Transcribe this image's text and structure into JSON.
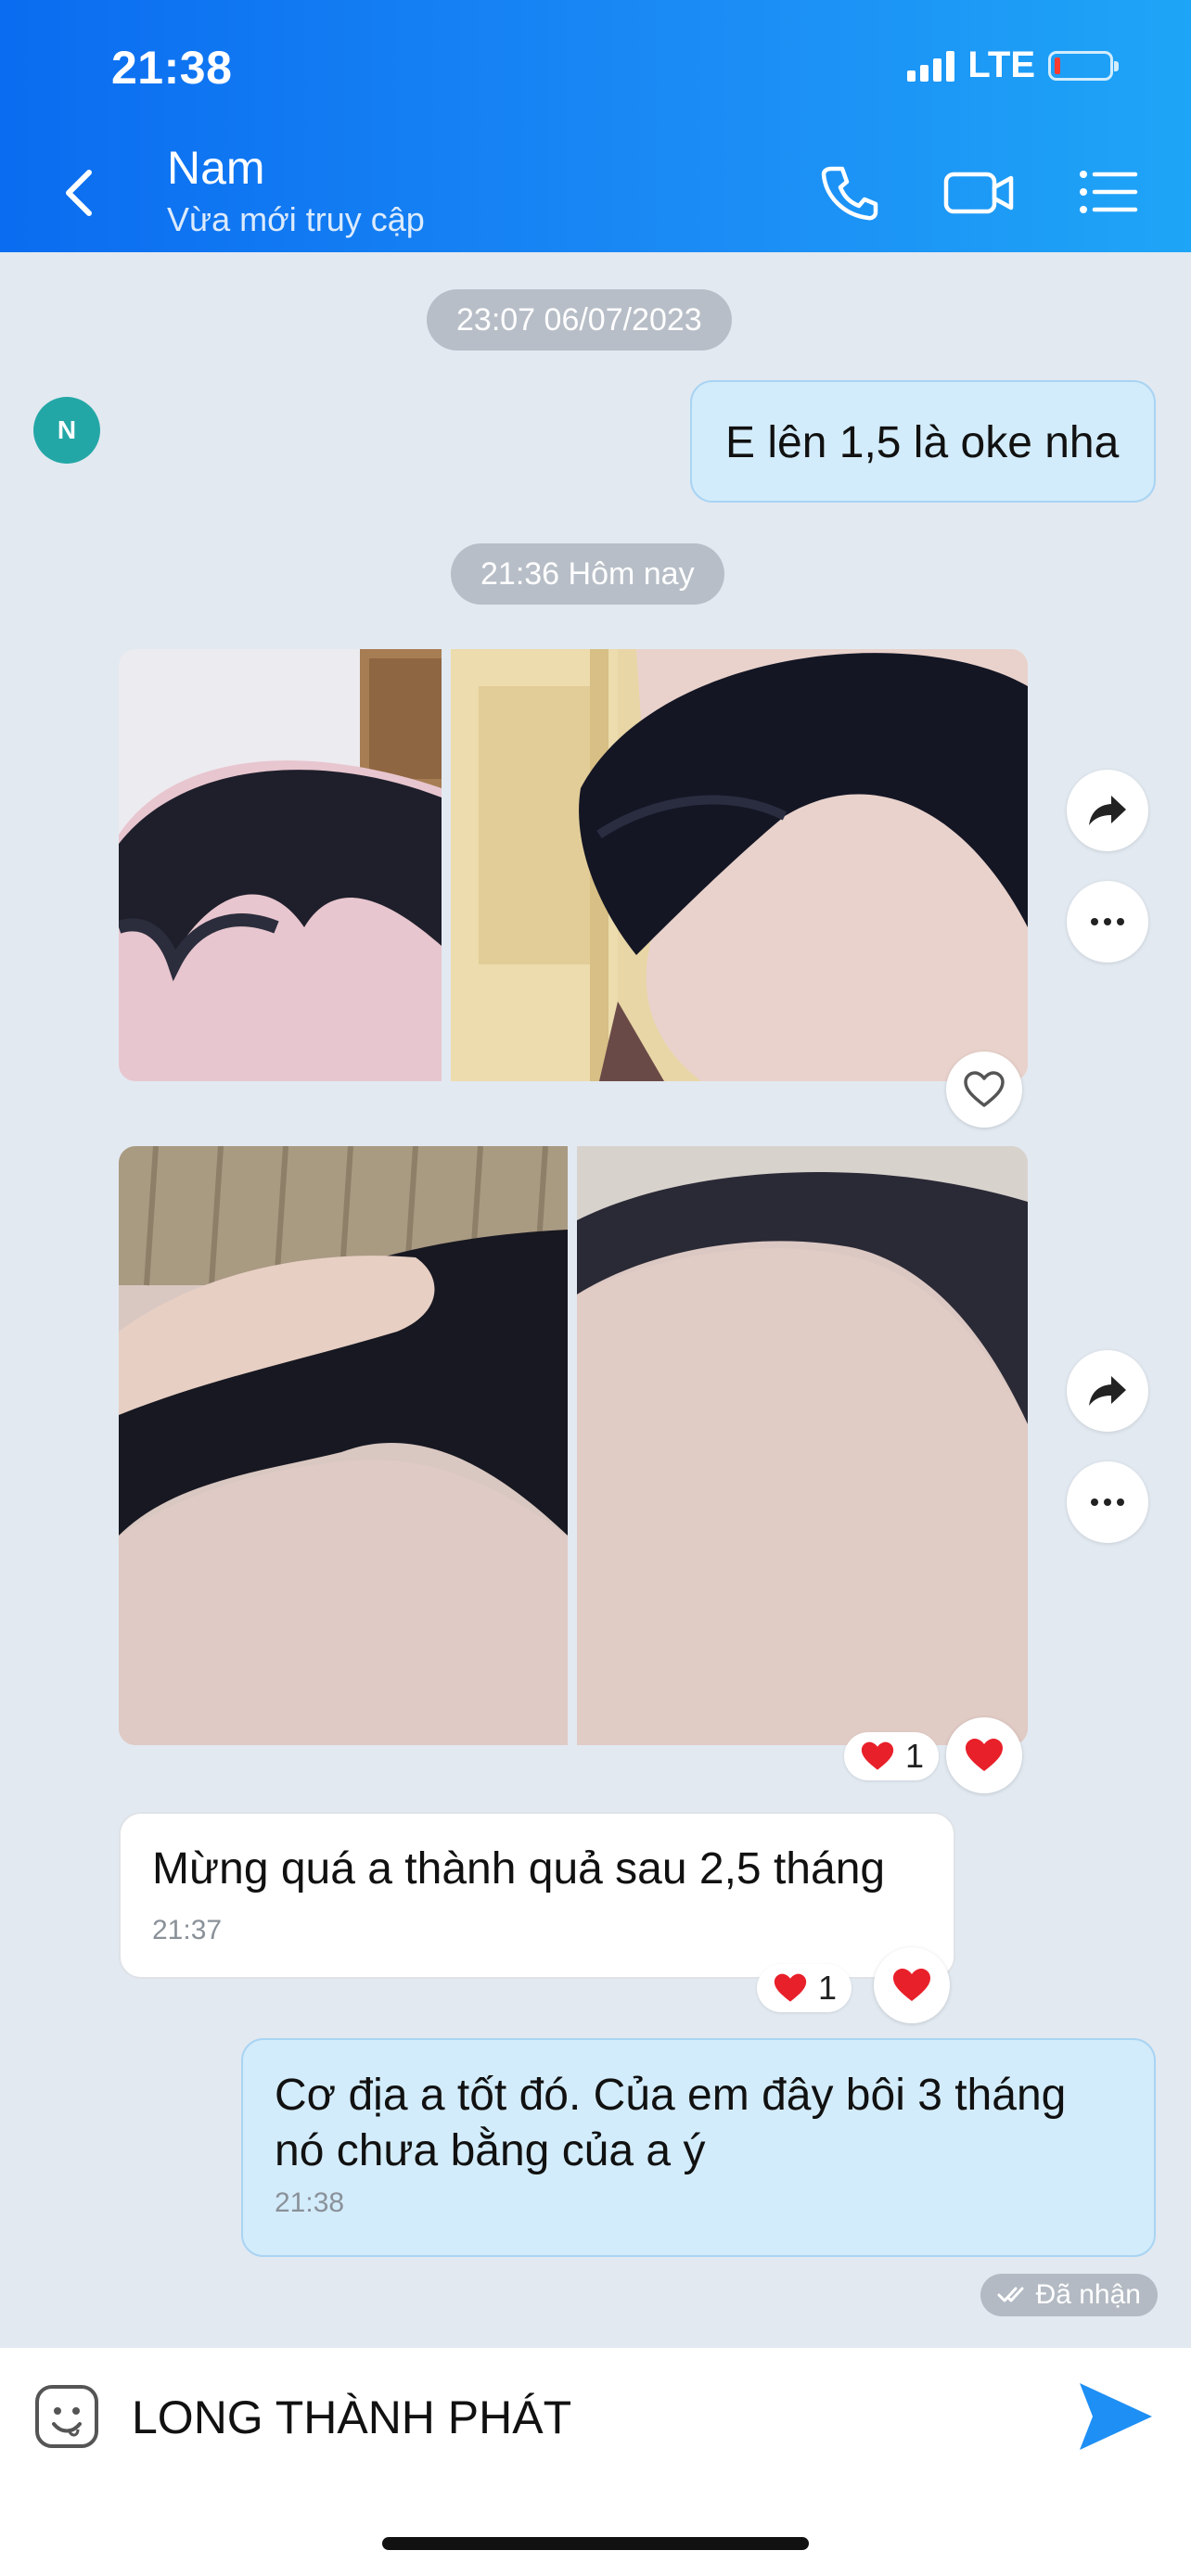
{
  "status_bar": {
    "time": "21:38",
    "network": "LTE",
    "battery_color": "#ff3b30"
  },
  "header": {
    "back_icon": "chevron-left-icon",
    "contact_name": "Nam",
    "contact_status": "Vừa mới truy cập",
    "call_icon": "phone-icon",
    "video_icon": "video-camera-icon",
    "menu_icon": "list-menu-icon"
  },
  "chat": {
    "timestamp_1": "23:07 06/07/2023",
    "msg_1": {
      "text": "E lên 1,5 là oke nha",
      "direction": "outgoing"
    },
    "timestamp_2": "21:36 Hôm nay",
    "avatar_initial": "N",
    "photo_group_1": {
      "photos": [
        "hair-crown-photo-1",
        "hair-crown-photo-2"
      ]
    },
    "photo_group_2": {
      "photos": [
        "hairline-photo-1",
        "hairline-photo-2"
      ],
      "reaction_count": "1"
    },
    "msg_2": {
      "text": "Mừng quá a thành quả sau 2,5 tháng",
      "time": "21:37",
      "reaction_count": "1",
      "direction": "incoming"
    },
    "msg_3": {
      "text": "Cơ địa a tốt đó. Của em đây bôi 3 tháng nó chưa bằng của a ý",
      "time": "21:38",
      "direction": "outgoing"
    },
    "receipt": "Đã nhận"
  },
  "composer": {
    "text": "LONG THÀNH PHÁT",
    "emoji_icon": "sticker-face-icon",
    "send_icon": "send-arrow-icon"
  },
  "colors": {
    "header": "#1b8cf5",
    "outgoing_bubble": "#d3ecfb",
    "chat_bg": "#e2e9f1",
    "heart": "#e8202a",
    "send": "#1e8ff5"
  }
}
